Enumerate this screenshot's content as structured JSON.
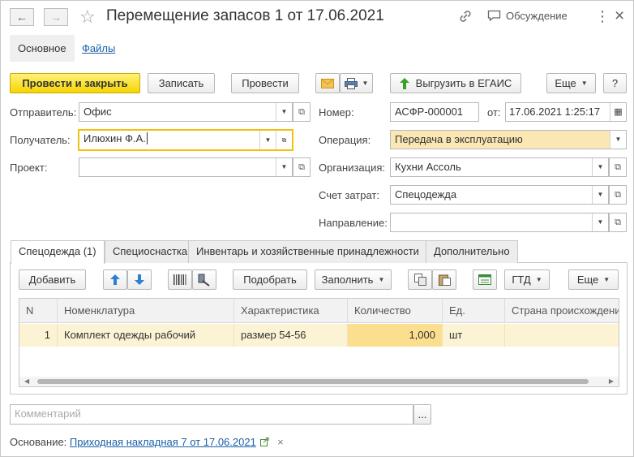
{
  "window": {
    "title": "Перемещение запасов 1 от 17.06.2021",
    "discussion_label": "Обсуждение",
    "menu_glyph": "⋮",
    "close_glyph": "×"
  },
  "top_tabs": [
    {
      "label": "Основное"
    },
    {
      "label": "Файлы"
    }
  ],
  "toolbar": {
    "post_close": "Провести и закрыть",
    "save": "Записать",
    "post": "Провести",
    "export_egais": "Выгрузить в ЕГАИС",
    "more": "Еще",
    "help": "?"
  },
  "form": {
    "sender_label": "Отправитель:",
    "sender_value": "Офис",
    "receiver_label": "Получатель:",
    "receiver_value": "Илюхин Ф.А.",
    "project_label": "Проект:",
    "project_value": "",
    "number_label": "Номер:",
    "number_value": "АСФР-000001",
    "date_label": "от:",
    "date_value": "17.06.2021  1:25:17",
    "operation_label": "Операция:",
    "operation_value": "Передача в эксплуатацию",
    "organization_label": "Организация:",
    "organization_value": "Кухни Ассоль",
    "cost_account_label": "Счет затрат:",
    "cost_account_value": "Спецодежда",
    "direction_label": "Направление:",
    "direction_value": ""
  },
  "tabs": [
    {
      "label": "Спецодежда (1)"
    },
    {
      "label": "Специоснастка"
    },
    {
      "label": "Инвентарь и хозяйственные принадлежности"
    },
    {
      "label": "Дополнительно"
    }
  ],
  "table_toolbar": {
    "add": "Добавить",
    "select": "Подобрать",
    "fill": "Заполнить",
    "gtd": "ГТД",
    "more": "Еще"
  },
  "table": {
    "columns": [
      "N",
      "Номенклатура",
      "Характеристика",
      "Количество",
      "Ед.",
      "Страна происхождения"
    ],
    "rows": [
      {
        "n": "1",
        "item": "Комплект одежды рабочий",
        "characteristic": "размер 54-56",
        "quantity": "1,000",
        "unit": "шт",
        "country": ""
      }
    ]
  },
  "comment": {
    "placeholder": "Комментарий",
    "button": "..."
  },
  "basis": {
    "label": "Основание:",
    "link": "Приходная накладная 7 от 17.06.2021",
    "clear_glyph": "×"
  },
  "colors": {
    "primary_button": "#f6d400",
    "link": "#1a5fa8",
    "selected_row": "#fbf3d4",
    "selected_cell": "#fcdf8e",
    "operation_field": "#fbe7b3",
    "focus_border": "#f0c20e",
    "export_arrow": "#3aa02b"
  }
}
